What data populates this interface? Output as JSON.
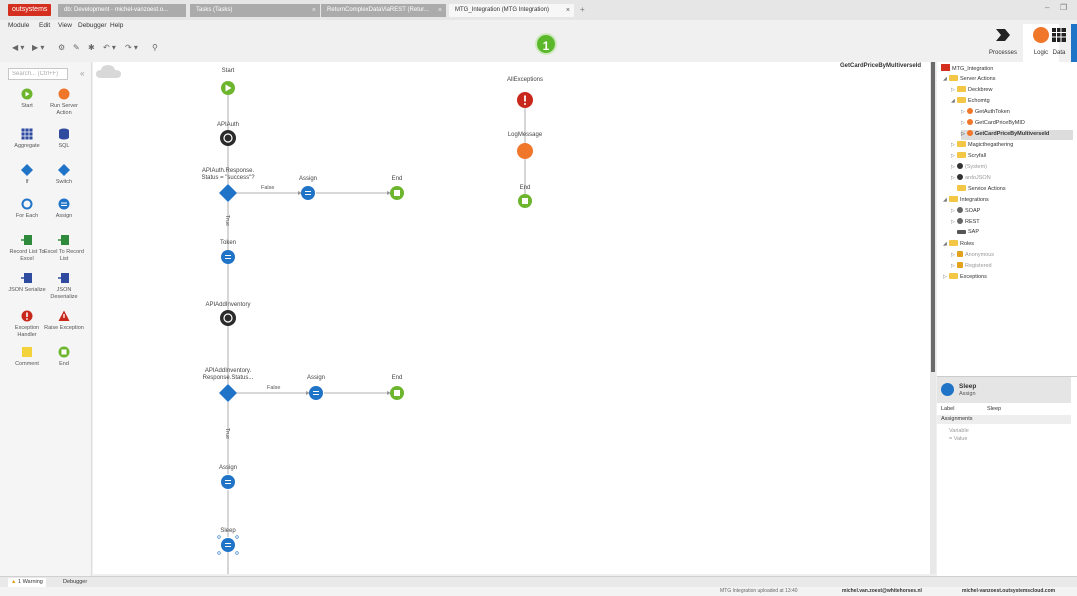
{
  "app": {
    "logo": "outsystems",
    "tabs": [
      {
        "label": "db: Development - michel-vanzoest.o..."
      },
      {
        "label": "Tasks (Tasks)"
      },
      {
        "label": "ReturnComplexDataViaREST (Retur..."
      },
      {
        "label": "MTG_Integration (MTG Integration)"
      }
    ],
    "new_tab": "+",
    "minimize": "–",
    "restore": "❐"
  },
  "menu": [
    "Module",
    "Edit",
    "View",
    "Debugger",
    "Help"
  ],
  "publish_badge": "1",
  "right_tabs": {
    "processes": "Processes",
    "logic": "Logic",
    "data": "Data"
  },
  "toolbox": {
    "search_placeholder": "Search... (Ctrl+F)",
    "tools": [
      {
        "label": "Start"
      },
      {
        "label": "Run Server Action"
      },
      {
        "label": "Aggregate"
      },
      {
        "label": "SQL"
      },
      {
        "label": "If"
      },
      {
        "label": "Switch"
      },
      {
        "label": "For Each"
      },
      {
        "label": "Assign"
      },
      {
        "label": "Record List To Excel"
      },
      {
        "label": "Excel To Record List"
      },
      {
        "label": "JSON Serialize"
      },
      {
        "label": "JSON Deserialize"
      },
      {
        "label": "Exception Handler"
      },
      {
        "label": "Raise Exception"
      },
      {
        "label": "Comment"
      },
      {
        "label": "End"
      }
    ]
  },
  "breadcrumb": "GetCardPriceByMultiverseId",
  "flow": {
    "start": "Start",
    "api_auth": "APIAuth",
    "if1": "APIAuth.Response.\nStatus = \"success\"?",
    "false1": "False",
    "assign1": "Assign",
    "end1": "End",
    "true1": "True",
    "token": "Token",
    "api_add": "APIAddInventory",
    "if2": "APIAddInventory.\nResponse.Status...",
    "false2": "False",
    "assign2": "Assign",
    "end2": "End",
    "true2": "True",
    "assign3": "Assign",
    "sleep": "Sleep",
    "all_exceptions": "AllExceptions",
    "log_message": "LogMessage",
    "end3": "End"
  },
  "tree": {
    "rows": [
      {
        "label": "MTG_Integration"
      },
      {
        "label": "Server Actions"
      },
      {
        "label": "Deckbrew"
      },
      {
        "label": "Echomtg"
      },
      {
        "label": "GetAuthToken"
      },
      {
        "label": "GetCardPriceByMID"
      },
      {
        "label": "GetCardPriceByMultiverseId"
      },
      {
        "label": "Magicthegathering"
      },
      {
        "label": "Scryfall"
      },
      {
        "label": "(System)"
      },
      {
        "label": "ardoJSON"
      },
      {
        "label": "Service Actions"
      },
      {
        "label": "Integrations"
      },
      {
        "label": "SOAP"
      },
      {
        "label": "REST"
      },
      {
        "label": "SAP"
      },
      {
        "label": "Roles"
      },
      {
        "label": "Anonymous"
      },
      {
        "label": "Registered"
      },
      {
        "label": "Exceptions"
      }
    ]
  },
  "properties": {
    "title": "Sleep",
    "subtitle": "Assign",
    "label_key": "Label",
    "label_value": "Sleep",
    "assignments": "Assignments",
    "variable": "Variable",
    "value": "= Value"
  },
  "bottom": {
    "warning_tab": "1 Warning",
    "debugger_tab": "Debugger",
    "status1": "MTG Integration uploaded at 13:40",
    "status2": "michel.van.zoest@whitehorses.nl",
    "status3": "michel-vanzoest.outsystemscloud.com"
  }
}
